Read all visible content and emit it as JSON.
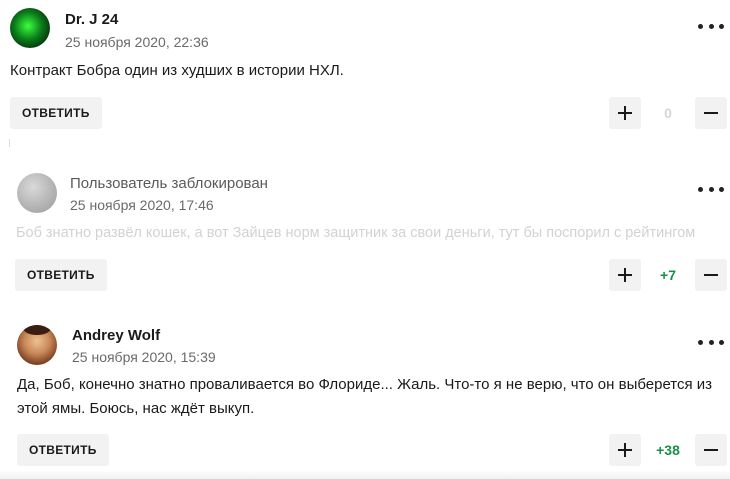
{
  "comments": [
    {
      "author": "Dr. J 24",
      "date": "25 ноября 2020, 22:36",
      "text": "Контракт Бобра один из худших в истории НХЛ.",
      "reply_label": "ОТВЕТИТЬ",
      "score": "0",
      "avatar_icon": "user-avatar-icon"
    },
    {
      "author": "Пользователь заблокирован",
      "date": "25 ноября 2020, 17:46",
      "text": "Боб знатно развёл кошек, а вот Зайцев норм защитник за свои деньги, тут бы поспорил с рейтингом",
      "reply_label": "ОТВЕТИТЬ",
      "score": "+7",
      "avatar_icon": "blocked-user-avatar-icon"
    },
    {
      "author": "Andrey Wolf",
      "date": "25 ноября 2020, 15:39",
      "text": "Да, Боб, конечно знатно проваливается во Флориде... Жаль. Что-то я не верю, что он выберется из этой ямы. Боюсь, нас ждёт выкуп.",
      "reply_label": "ОТВЕТИТЬ",
      "score": "+38",
      "avatar_icon": "user-avatar-icon"
    }
  ],
  "colors": {
    "score_positive": "#1a8f4a",
    "score_neutral": "#d6d6d6",
    "button_bg": "#f2f2f2",
    "blocked_text": "#d2d2d2"
  },
  "icons": {
    "menu": "more-options-icon",
    "upvote": "plus-icon",
    "downvote": "minus-icon"
  }
}
